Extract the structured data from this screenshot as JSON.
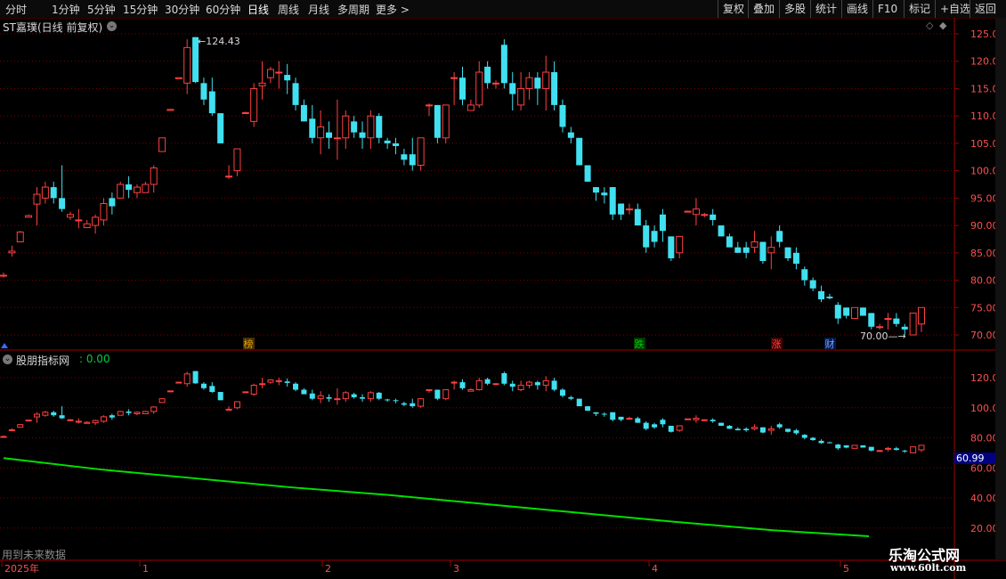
{
  "toolbar": {
    "timeframes": [
      "分时",
      "1分钟",
      "5分钟",
      "15分钟",
      "30分钟",
      "60分钟",
      "日线",
      "周线",
      "月线",
      "多周期",
      "更多 >"
    ],
    "buttons": [
      "复权",
      "叠加",
      "多股",
      "统计",
      "画线",
      "F10",
      "标记",
      "+自选",
      "返回"
    ]
  },
  "stock_title": "ST嘉璞(日线 前复权)",
  "high_label": "124.43",
  "low_label": "70.00",
  "event_markers": [
    {
      "text": "榜",
      "color": "#e0a000",
      "bg": "#4a3000"
    },
    {
      "text": "跌",
      "color": "#00d000",
      "bg": "#003a00"
    },
    {
      "text": "涨",
      "color": "#ff4040",
      "bg": "#4a0000"
    },
    {
      "text": "财",
      "color": "#80a0ff",
      "bg": "#001a4a"
    }
  ],
  "indicator": {
    "title": "股朋指标网",
    "value_label": ": 0.00",
    "current_value": "60.99"
  },
  "future_text": "用到未来数据",
  "x_axis": [
    "2025年",
    "1",
    "2",
    "3",
    "4",
    "5"
  ],
  "watermark": {
    "line1": "乐淘公式网",
    "line2": "www.60lt.com"
  },
  "colors": {
    "up": "#ff4040",
    "down": "#40e0f0",
    "line": "#00e000",
    "grid": "#7a0000"
  },
  "chart_data": [
    {
      "type": "candlestick",
      "title": "ST嘉璞(日线 前复权)",
      "y_ticks": [
        125,
        120,
        115,
        110,
        105,
        100,
        95,
        90,
        85,
        80,
        75,
        70
      ],
      "ylim": [
        68,
        126.5
      ],
      "x_labels": [
        "2025年",
        "1",
        "2",
        "3",
        "4",
        "5"
      ],
      "ohlc": [
        [
          80.9,
          81.4,
          80.5,
          80.9
        ],
        [
          85.0,
          86.3,
          84.3,
          85.3
        ],
        [
          87.0,
          89.0,
          87.0,
          88.8
        ],
        [
          91.5,
          92.0,
          91.5,
          91.8
        ],
        [
          93.9,
          97.0,
          90.0,
          95.7
        ],
        [
          95.0,
          98.0,
          94.0,
          97.0
        ],
        [
          97.0,
          98.0,
          94.0,
          95.0
        ],
        [
          95.0,
          101.0,
          92.5,
          93.0
        ],
        [
          91.5,
          92.5,
          91.0,
          92.0
        ],
        [
          91.0,
          93.0,
          89.5,
          91.0
        ],
        [
          89.6,
          91.0,
          89.6,
          90.3
        ],
        [
          90.0,
          92.0,
          88.5,
          91.5
        ],
        [
          91.0,
          95.0,
          90.0,
          94.0
        ],
        [
          95.0,
          96.0,
          92.0,
          93.5
        ],
        [
          95.0,
          98.0,
          95.0,
          97.5
        ],
        [
          97.5,
          99.0,
          95.0,
          96.5
        ],
        [
          96.0,
          97.5,
          95.0,
          97.0
        ],
        [
          96.0,
          98.0,
          96.0,
          97.5
        ],
        [
          97.5,
          101.0,
          96.0,
          100.5
        ],
        [
          103.5,
          106.0,
          103.5,
          106.0
        ],
        [
          111.0,
          111.3,
          111.0,
          111.2
        ],
        [
          116.8,
          117.0,
          116.8,
          117.0
        ],
        [
          116.0,
          124.0,
          114.0,
          122.5
        ],
        [
          124.4,
          124.4,
          116.0,
          116.2
        ],
        [
          116.0,
          117.0,
          112.0,
          113.0
        ],
        [
          114.5,
          117.0,
          110.0,
          110.5
        ],
        [
          110.5,
          110.5,
          105.0,
          105.0
        ],
        [
          99.0,
          101.0,
          98.5,
          99.0
        ],
        [
          100.0,
          104.0,
          99.0,
          104.0
        ],
        [
          110.5,
          110.8,
          110.5,
          110.6
        ],
        [
          109.0,
          116.0,
          108.0,
          115.0
        ],
        [
          115.5,
          120.0,
          113.0,
          116.0
        ],
        [
          117.0,
          119.0,
          116.0,
          118.5
        ],
        [
          118.0,
          120.0,
          115.0,
          118.0
        ],
        [
          117.5,
          119.5,
          114.0,
          116.5
        ],
        [
          116.0,
          117.0,
          111.0,
          112.0
        ],
        [
          112.0,
          113.0,
          109.0,
          109.0
        ],
        [
          109.5,
          112.0,
          105.0,
          106.0
        ],
        [
          106.0,
          111.0,
          103.0,
          108.0
        ],
        [
          107.0,
          109.0,
          104.0,
          106.0
        ],
        [
          106.0,
          113.0,
          102.0,
          106.0
        ],
        [
          106.0,
          111.0,
          104.0,
          110.0
        ],
        [
          109.0,
          110.0,
          106.0,
          107.0
        ],
        [
          107.0,
          109.0,
          104.0,
          106.0
        ],
        [
          106.0,
          111.0,
          104.0,
          110.0
        ],
        [
          110.0,
          110.5,
          105.0,
          106.0
        ],
        [
          105.5,
          106.0,
          104.0,
          105.0
        ],
        [
          105.0,
          106.0,
          103.0,
          104.5
        ],
        [
          103.0,
          104.0,
          101.0,
          102.0
        ],
        [
          103.0,
          106.0,
          100.0,
          101.0
        ],
        [
          101.0,
          106.0,
          100.0,
          106.0
        ],
        [
          112.0,
          112.3,
          110.0,
          112.0
        ],
        [
          112.0,
          112.0,
          105.0,
          106.0
        ],
        [
          106.0,
          112.0,
          105.0,
          112.0
        ],
        [
          117.0,
          118.0,
          112.0,
          117.0
        ],
        [
          117.0,
          119.0,
          112.0,
          113.0
        ],
        [
          111.0,
          113.0,
          111.0,
          112.0
        ],
        [
          112.0,
          120.0,
          111.5,
          118.0
        ],
        [
          119.0,
          120.0,
          115.0,
          116.0
        ],
        [
          116.0,
          116.5,
          115.0,
          116.0
        ],
        [
          123.0,
          124.0,
          115.0,
          116.0
        ],
        [
          116.0,
          118.0,
          111.0,
          114.0
        ],
        [
          112.0,
          118.0,
          111.0,
          115.0
        ],
        [
          115.0,
          118.0,
          113.0,
          117.0
        ],
        [
          117.0,
          118.0,
          112.0,
          115.0
        ],
        [
          115.0,
          121.0,
          111.0,
          118.0
        ],
        [
          118.0,
          120.0,
          111.0,
          112.0
        ],
        [
          112.0,
          113.0,
          107.0,
          108.0
        ],
        [
          107.0,
          108.0,
          105.0,
          106.0
        ],
        [
          106.0,
          106.0,
          101.0,
          101.0
        ],
        [
          101.0,
          101.0,
          98.0,
          98.0
        ],
        [
          97.0,
          97.0,
          94.5,
          96.0
        ],
        [
          96.0,
          97.0,
          94.0,
          95.5
        ],
        [
          97.0,
          97.0,
          91.0,
          92.0
        ],
        [
          94.0,
          94.0,
          91.0,
          92.0
        ],
        [
          93.0,
          94.0,
          92.0,
          93.0
        ],
        [
          93.0,
          94.0,
          90.0,
          90.0
        ],
        [
          90.0,
          91.0,
          85.0,
          86.0
        ],
        [
          89.0,
          90.0,
          86.0,
          87.0
        ],
        [
          92.0,
          93.0,
          87.0,
          89.0
        ],
        [
          88.0,
          88.0,
          83.5,
          84.0
        ],
        [
          85.0,
          88.0,
          84.0,
          88.0
        ],
        [
          92.5,
          92.7,
          92.5,
          92.6
        ],
        [
          92.0,
          95.0,
          90.0,
          93.0
        ],
        [
          92.0,
          92.3,
          91.5,
          92.0
        ],
        [
          92.0,
          93.0,
          90.0,
          91.0
        ],
        [
          90.0,
          90.0,
          88.0,
          88.0
        ],
        [
          88.0,
          88.5,
          86.0,
          86.0
        ],
        [
          86.0,
          87.0,
          85.0,
          85.0
        ],
        [
          86.0,
          87.0,
          84.0,
          85.0
        ],
        [
          86.0,
          89.0,
          85.0,
          87.0
        ],
        [
          87.0,
          87.0,
          83.0,
          83.5
        ],
        [
          85.0,
          88.0,
          82.0,
          86.0
        ],
        [
          89.0,
          90.0,
          86.0,
          87.0
        ],
        [
          86.0,
          86.0,
          83.5,
          84.0
        ],
        [
          85.0,
          86.0,
          82.0,
          83.0
        ],
        [
          82.0,
          82.5,
          79.0,
          80.0
        ],
        [
          80.0,
          80.5,
          78.0,
          78.5
        ],
        [
          78.0,
          79.0,
          76.0,
          76.5
        ],
        [
          77.0,
          77.5,
          76.5,
          76.7
        ],
        [
          75.5,
          76.0,
          72.0,
          73.0
        ],
        [
          75.0,
          75.0,
          73.0,
          73.5
        ],
        [
          73.0,
          75.0,
          73.0,
          75.0
        ],
        [
          75.0,
          75.0,
          73.5,
          73.5
        ],
        [
          74.0,
          74.0,
          71.0,
          71.5
        ],
        [
          71.5,
          72.0,
          71.0,
          71.5
        ],
        [
          73.0,
          74.0,
          71.0,
          73.0
        ],
        [
          73.0,
          74.0,
          71.5,
          72.0
        ],
        [
          71.5,
          72.0,
          70.0,
          71.0
        ],
        [
          70.0,
          74.0,
          70.0,
          74.0
        ],
        [
          72.0,
          75.0,
          70.5,
          75.0
        ]
      ]
    },
    {
      "type": "line",
      "title": "股朋指标网",
      "y_ticks": [
        120,
        100,
        80,
        60,
        40,
        20
      ],
      "ylim": [
        15,
        133
      ],
      "series": [
        {
          "values": [
            [
              0,
              66.5
            ],
            [
              20,
              59
            ],
            [
              40,
              53
            ],
            [
              60,
              47
            ],
            [
              80,
              42
            ],
            [
              100,
              36
            ],
            [
              120,
              30
            ],
            [
              140,
              24
            ],
            [
              160,
              18.5
            ],
            [
              180,
              14.5
            ]
          ]
        }
      ]
    }
  ]
}
